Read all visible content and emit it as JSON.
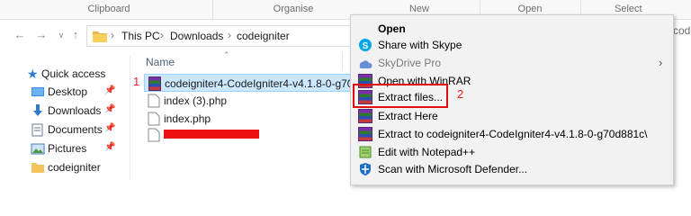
{
  "ribbon": {
    "groups": [
      "Clipboard",
      "Organise",
      "New",
      "Open",
      "Select"
    ]
  },
  "address": {
    "crumbs": [
      "This PC",
      "Downloads",
      "codeigniter"
    ],
    "right_fragment": "code"
  },
  "sidebar": {
    "quick_access": "Quick access",
    "items": [
      {
        "label": "Desktop",
        "icon": "desktop-icon"
      },
      {
        "label": "Downloads",
        "icon": "download-arrow-icon"
      },
      {
        "label": "Documents",
        "icon": "documents-icon"
      },
      {
        "label": "Pictures",
        "icon": "pictures-icon"
      },
      {
        "label": "codeigniter",
        "icon": "folder-icon"
      }
    ]
  },
  "filelist": {
    "column_name": "Name",
    "files": [
      {
        "name": "codeigniter4-CodeIgniter4-v4.1.8-0-g70d...",
        "icon": "winrar-archive-icon"
      },
      {
        "name": "index (3).php",
        "icon": "php-file-icon"
      },
      {
        "name": "index.php",
        "icon": "php-file-icon"
      },
      {
        "name": "",
        "icon": "file-icon"
      }
    ]
  },
  "annotations": {
    "step1": "1",
    "step2": "2"
  },
  "context_menu": {
    "items": [
      {
        "label": "Open",
        "icon": "",
        "style": "bold"
      },
      {
        "label": "Share with Skype",
        "icon": "skype-icon"
      },
      {
        "label": "SkyDrive Pro",
        "icon": "skydrive-icon",
        "style": "disabled",
        "submenu": true
      },
      {
        "label": "Open with WinRAR",
        "icon": "winrar-icon"
      },
      {
        "label": "Extract files...",
        "icon": "winrar-icon"
      },
      {
        "label": "Extract Here",
        "icon": "winrar-icon"
      },
      {
        "label": "Extract to codeigniter4-CodeIgniter4-v4.1.8-0-g70d881c\\",
        "icon": "winrar-icon"
      },
      {
        "label": "Edit with Notepad++",
        "icon": "notepad-plus-plus-icon"
      },
      {
        "label": "Scan with Microsoft Defender...",
        "icon": "defender-shield-icon"
      }
    ]
  },
  "colors": {
    "selection": "#cce8ff",
    "annotation_red": "#e01010"
  }
}
